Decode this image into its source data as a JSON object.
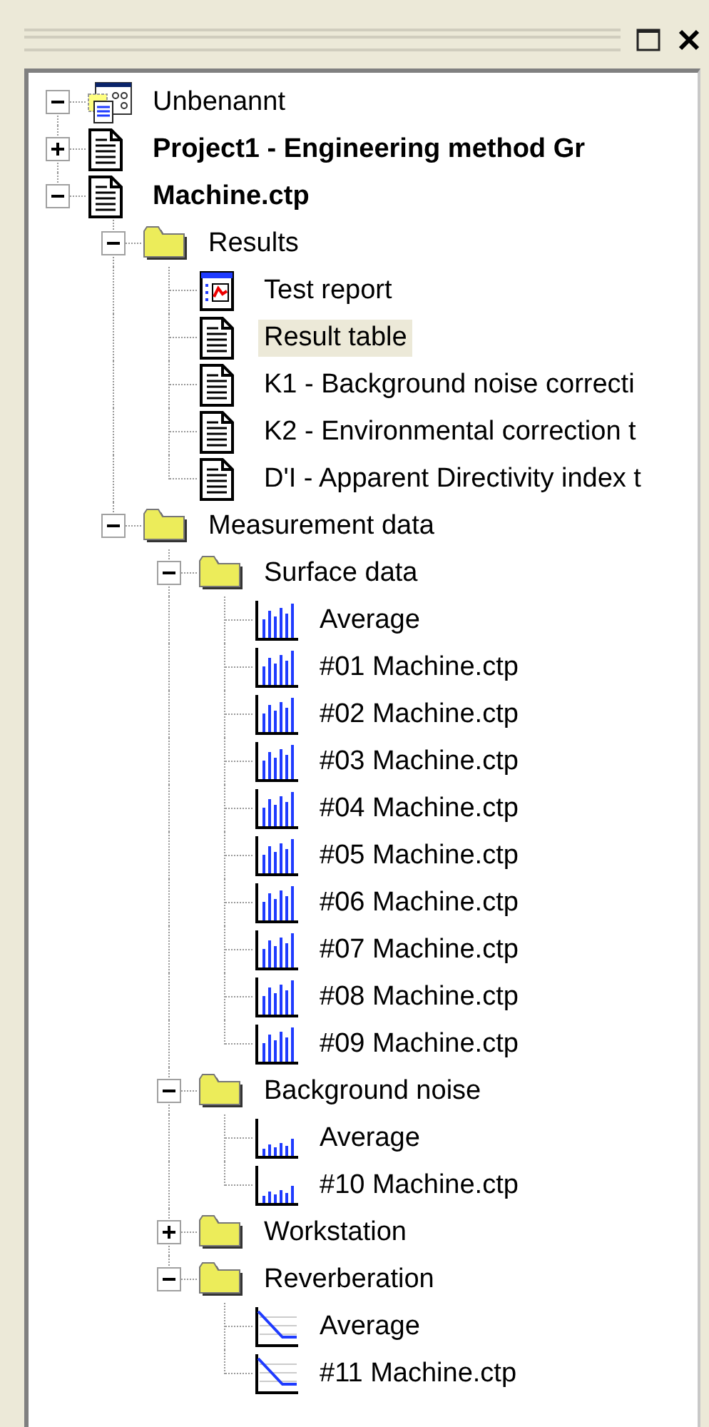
{
  "tree": [
    {
      "label": "Unbenannt",
      "kind": "workspace",
      "bold": false,
      "expanded": true,
      "selected": false
    },
    {
      "label": "Project1 - Engineering method Gr",
      "kind": "document",
      "bold": true,
      "expanded": false,
      "selected": false
    },
    {
      "label": "Machine.ctp",
      "kind": "document",
      "bold": true,
      "expanded": true,
      "selected": false,
      "children": [
        {
          "label": "Results",
          "kind": "folder",
          "expanded": true,
          "selected": false,
          "children": [
            {
              "label": "Test report",
              "kind": "report",
              "selected": false
            },
            {
              "label": "Result table",
              "kind": "document",
              "selected": true
            },
            {
              "label": "K1 - Background noise correcti",
              "kind": "document",
              "selected": false
            },
            {
              "label": "K2 - Environmental correction t",
              "kind": "document",
              "selected": false
            },
            {
              "label": "D'I - Apparent Directivity index t",
              "kind": "document",
              "selected": false
            }
          ]
        },
        {
          "label": "Measurement data",
          "kind": "folder",
          "expanded": true,
          "selected": false,
          "children": [
            {
              "label": "Surface data",
              "kind": "folder",
              "expanded": true,
              "selected": false,
              "children": [
                {
                  "label": "Average",
                  "kind": "spectrum",
                  "selected": false
                },
                {
                  "label": "#01 Machine.ctp",
                  "kind": "spectrum",
                  "selected": false
                },
                {
                  "label": "#02 Machine.ctp",
                  "kind": "spectrum",
                  "selected": false
                },
                {
                  "label": "#03 Machine.ctp",
                  "kind": "spectrum",
                  "selected": false
                },
                {
                  "label": "#04 Machine.ctp",
                  "kind": "spectrum",
                  "selected": false
                },
                {
                  "label": "#05 Machine.ctp",
                  "kind": "spectrum",
                  "selected": false
                },
                {
                  "label": "#06 Machine.ctp",
                  "kind": "spectrum",
                  "selected": false
                },
                {
                  "label": "#07 Machine.ctp",
                  "kind": "spectrum",
                  "selected": false
                },
                {
                  "label": "#08 Machine.ctp",
                  "kind": "spectrum",
                  "selected": false
                },
                {
                  "label": "#09 Machine.ctp",
                  "kind": "spectrum",
                  "selected": false
                }
              ]
            },
            {
              "label": "Background noise",
              "kind": "folder",
              "expanded": true,
              "selected": false,
              "children": [
                {
                  "label": "Average",
                  "kind": "spectrum-low",
                  "selected": false
                },
                {
                  "label": "#10 Machine.ctp",
                  "kind": "spectrum-low",
                  "selected": false
                }
              ]
            },
            {
              "label": "Workstation",
              "kind": "folder",
              "expanded": false,
              "selected": false
            },
            {
              "label": "Reverberation",
              "kind": "folder",
              "expanded": true,
              "selected": false,
              "children": [
                {
                  "label": "Average",
                  "kind": "decay",
                  "selected": false
                },
                {
                  "label": "#11 Machine.ctp",
                  "kind": "decay",
                  "selected": false
                }
              ]
            }
          ]
        }
      ]
    }
  ]
}
